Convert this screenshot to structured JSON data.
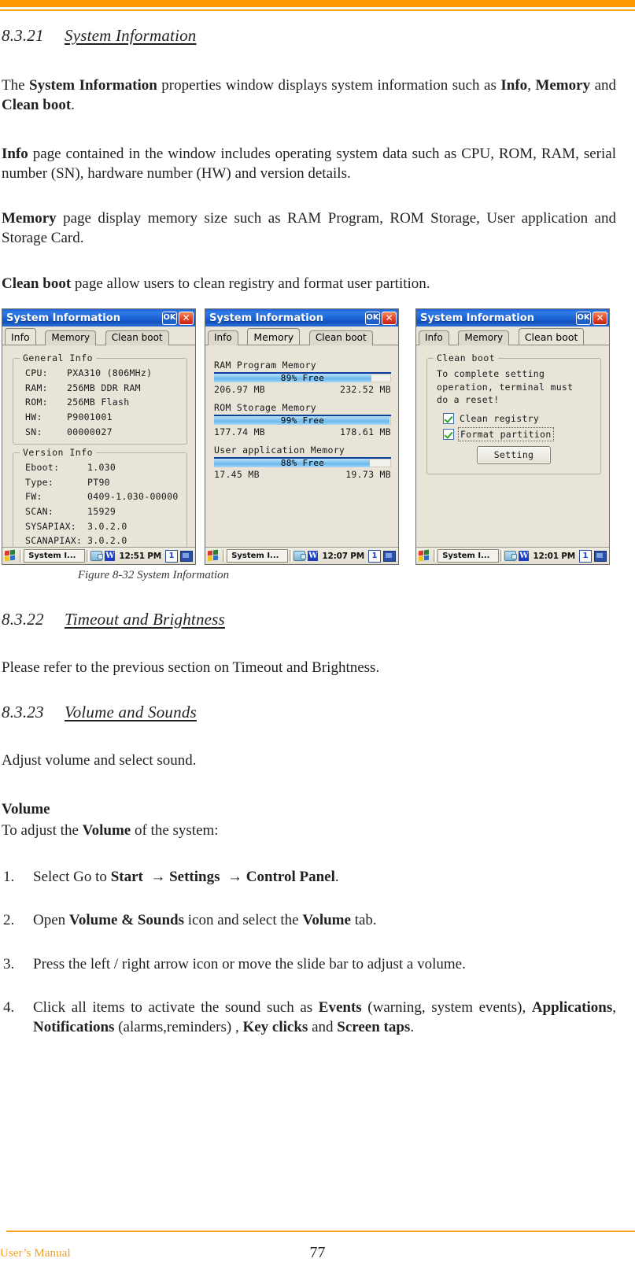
{
  "page": {
    "footer_left": "User’s Manual",
    "page_number": "77"
  },
  "sections": {
    "s21": {
      "number": "8.3.21",
      "title": "System Information"
    },
    "s22": {
      "number": "8.3.22",
      "title": "Timeout and Brightness"
    },
    "s23": {
      "number": "8.3.23",
      "title": "Volume and Sounds"
    }
  },
  "paragraphs": {
    "intro_1": "The System Information properties window displays system information such as Info, Memory and Clean boot.",
    "intro_2": "Info page contained in the window includes operating system data such as CPU, ROM, RAM, serial number (SN), hardware number (HW) and version details.",
    "intro_3": "Memory page display memory size such as RAM Program, ROM Storage, User application and Storage Card.",
    "intro_4": "Clean boot page allow users to clean registry and format user partition.",
    "timeout_body": "Please refer to the previous section on Timeout and Brightness.",
    "volume_body": "Adjust volume and select sound.",
    "volume_heading": "Volume",
    "volume_lead": "To adjust the Volume of the system:"
  },
  "steps": [
    {
      "marker": "1.",
      "text": "Select Go to Start → Settings → Control Panel."
    },
    {
      "marker": "2.",
      "text": "Open Volume & Sounds icon and select the Volume tab."
    },
    {
      "marker": "3.",
      "text": "Press the left / right arrow icon or move the slide bar to adjust a volume."
    },
    {
      "marker": "4.",
      "text": "Click all items to activate the sound such as Events (warning, system events), Applications, Notifications (alarms,reminders) , Key clicks and Screen taps."
    }
  ],
  "figure": {
    "caption": "Figure 8-32 System Information",
    "window_title": "System Information",
    "titlebar_ok": "OK",
    "titlebar_close": "✕",
    "tabs": [
      "Info",
      "Memory",
      "Clean boot"
    ],
    "panels": [
      {
        "active_tab": "Info",
        "groups": [
          {
            "legend": "General Info",
            "rows": [
              {
                "key": "CPU:",
                "value": "PXA310 (806MHz)"
              },
              {
                "key": "RAM:",
                "value": "256MB DDR RAM"
              },
              {
                "key": "ROM:",
                "value": "256MB Flash"
              },
              {
                "key": "HW:",
                "value": "P9001001"
              },
              {
                "key": "SN:",
                "value": "00000027"
              }
            ]
          },
          {
            "legend": "Version Info",
            "rows": [
              {
                "key": "Eboot:",
                "value": "1.030"
              },
              {
                "key": "Type:",
                "value": "PT90"
              },
              {
                "key": "FW:",
                "value": "0409-1.030-00000"
              },
              {
                "key": "SCAN:",
                "value": "15929"
              },
              {
                "key": "SYSAPIAX:",
                "value": "3.0.2.0"
              },
              {
                "key": "SCANAPIAX:",
                "value": "3.0.2.0"
              }
            ]
          }
        ],
        "taskbar": {
          "start_label": "",
          "task_label": "System I...",
          "clock": "12:51 PM",
          "tray_num": "1",
          "tray_w": "W"
        }
      },
      {
        "active_tab": "Memory",
        "memory": [
          {
            "title": "RAM Program Memory",
            "pct_label": "89% Free",
            "pct": 89,
            "free": "206.97 MB",
            "total": "232.52 MB"
          },
          {
            "title": "ROM Storage Memory",
            "pct_label": "99% Free",
            "pct": 99,
            "free": "177.74 MB",
            "total": "178.61 MB"
          },
          {
            "title": "User application Memory",
            "pct_label": "88% Free",
            "pct": 88,
            "free": "17.45 MB",
            "total": "19.73 MB"
          }
        ],
        "taskbar": {
          "start_label": "",
          "task_label": "System I...",
          "clock": "12:07 PM",
          "tray_num": "1",
          "tray_w": "W"
        }
      },
      {
        "active_tab": "Clean boot",
        "clean_boot": {
          "legend": "Clean boot",
          "message": "To complete setting\noperation, terminal must\ndo a reset!",
          "checkbox_1": "Clean registry",
          "checkbox_2": "Format partition",
          "button": "Setting"
        },
        "taskbar": {
          "start_label": "",
          "task_label": "System I...",
          "clock": "12:01 PM",
          "tray_num": "1",
          "tray_w": "W"
        }
      }
    ]
  },
  "colors": {
    "rule_orange": "#ff9900",
    "footer_orange": "#f5a11e",
    "titlebar_blue": "#1f67d8",
    "bar_fill_blue": "#8ccaf2",
    "check_green": "#2aa52a"
  }
}
